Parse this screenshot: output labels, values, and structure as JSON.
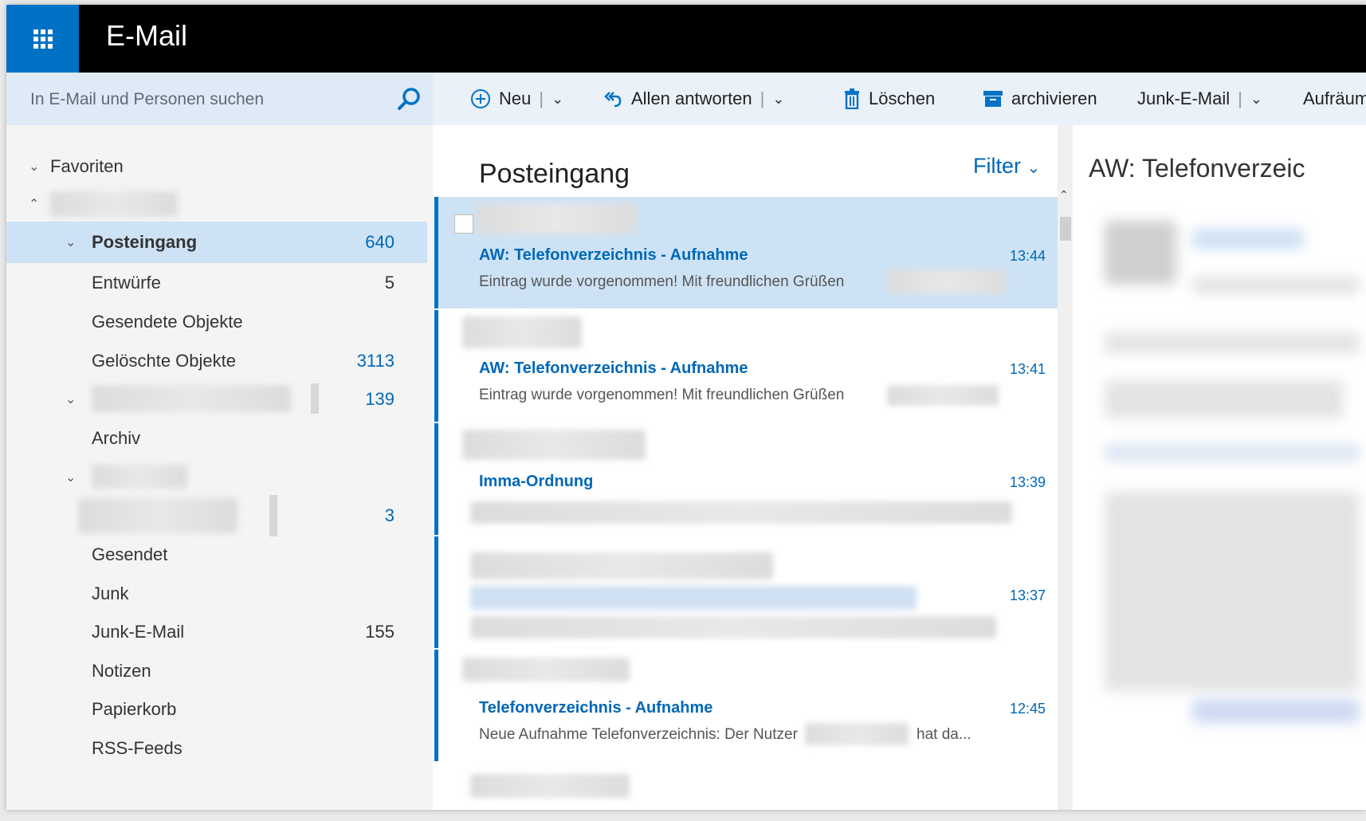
{
  "app": {
    "title": "E-Mail"
  },
  "search": {
    "placeholder": "In E-Mail und Personen suchen"
  },
  "toolbar": {
    "new_label": "Neu",
    "reply_all_label": "Allen antworten",
    "delete_label": "Löschen",
    "archive_label": "archivieren",
    "junk_label": "Junk-E-Mail",
    "cleanup_label": "Aufräum"
  },
  "sidebar": {
    "favorites_label": "Favoriten",
    "items": [
      {
        "label": "Posteingang",
        "count": "640"
      },
      {
        "label": "Entwürfe",
        "count": "5"
      },
      {
        "label": "Gesendete Objekte",
        "count": ""
      },
      {
        "label": "Gelöschte Objekte",
        "count": "3113"
      },
      {
        "label": "",
        "count": "139"
      },
      {
        "label": "Archiv",
        "count": ""
      },
      {
        "label": "",
        "count": ""
      },
      {
        "label": "",
        "count": "3"
      },
      {
        "label": "Gesendet",
        "count": ""
      },
      {
        "label": "Junk",
        "count": ""
      },
      {
        "label": "Junk-E-Mail",
        "count": "155"
      },
      {
        "label": "Notizen",
        "count": ""
      },
      {
        "label": "Papierkorb",
        "count": ""
      },
      {
        "label": "RSS-Feeds",
        "count": ""
      }
    ]
  },
  "list": {
    "title": "Posteingang",
    "filter_label": "Filter",
    "messages": [
      {
        "subject": "AW: Telefonverzeichnis - Aufnahme",
        "time": "13:44",
        "preview": "Eintrag wurde vorgenommen! Mit freundlichen Grüßen"
      },
      {
        "subject": "AW: Telefonverzeichnis - Aufnahme",
        "time": "13:41",
        "preview": "Eintrag wurde vorgenommen! Mit freundlichen Grüßen"
      },
      {
        "subject": "Imma-Ordnung",
        "time": "13:39",
        "preview": ""
      },
      {
        "subject": "",
        "time": "13:37",
        "preview": ""
      },
      {
        "subject": "Telefonverzeichnis - Aufnahme",
        "time": "12:45",
        "preview": "Neue Aufnahme Telefonverzeichnis: Der Nutzer",
        "preview_tail": "hat da..."
      }
    ]
  },
  "reading": {
    "title": "AW: Telefonverzeic"
  },
  "colors": {
    "accent": "#0072c6",
    "selected": "#cde3f5",
    "link": "#0067b8"
  }
}
